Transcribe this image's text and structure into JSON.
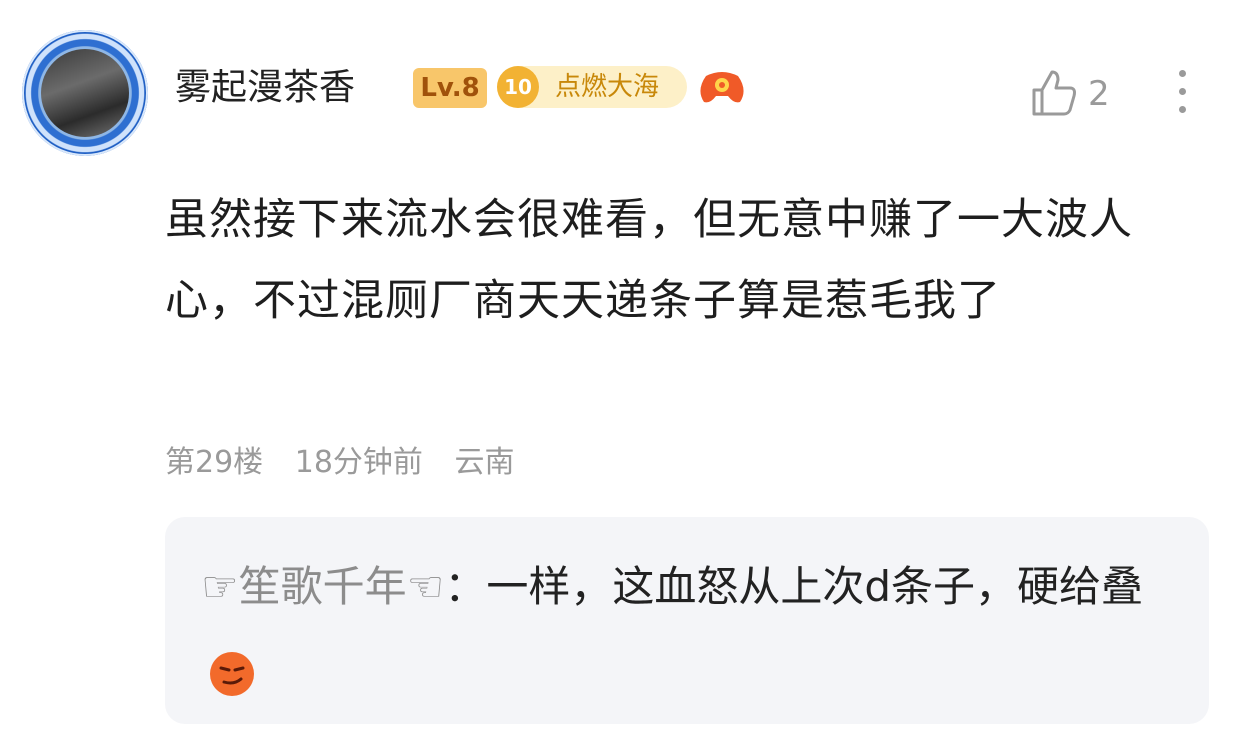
{
  "comment": {
    "username": "雾起漫茶香",
    "level_badge": "Lv.8",
    "fan_badge": {
      "level": "10",
      "name": "点燃大海"
    },
    "like_count": "2",
    "text": "虽然接下来流水会很难看，但无意中赚了一大波人心，不过混厕厂商天天递条子算是惹毛我了",
    "floor": "第29楼",
    "time": "18分钟前",
    "location": "云南"
  },
  "reply": {
    "author": "☞笙歌千年☜",
    "separator": "：",
    "text": "一样，这血怒从上次d条子，硬给叠"
  },
  "icons": [
    "avatar",
    "game-controller-icon",
    "thumbs-up-icon",
    "more-icon",
    "smirk-emoji-icon"
  ],
  "colors": {
    "level_badge": "#f8c66a",
    "fan_badge_bg": "#fdf0c8",
    "reply_bg": "#f4f5f8",
    "meta_text": "#9a9a9a"
  }
}
